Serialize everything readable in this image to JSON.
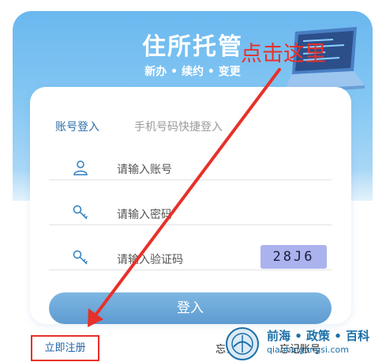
{
  "banner": {
    "title": "住所托管",
    "subtitle": "新办 • 续约 • 变更"
  },
  "tabs": [
    {
      "label": "账号登入",
      "active": true
    },
    {
      "label": "手机号码快捷登入",
      "active": false
    }
  ],
  "fields": {
    "account": {
      "placeholder": "请输入账号",
      "icon": "user-icon"
    },
    "password": {
      "placeholder": "请输入密码",
      "icon": "key-icon"
    },
    "captcha": {
      "placeholder": "请输入验证码",
      "icon": "key-icon",
      "code": "28J6"
    }
  },
  "login_button": "登入",
  "links": {
    "register": "立即注册",
    "forgot_password": "忘记密码",
    "forgot_account": "忘记账号"
  },
  "annotation": {
    "text": "点击这里",
    "color": "#e8302a"
  },
  "watermark": {
    "line1": "前海 • 政策 • 百科",
    "line2": "qianhaigongsi.com"
  },
  "colors": {
    "accent": "#2e6ea8",
    "banner": "#6ab8ef",
    "button": "#5e9bd0",
    "annotation": "#e8302a"
  }
}
